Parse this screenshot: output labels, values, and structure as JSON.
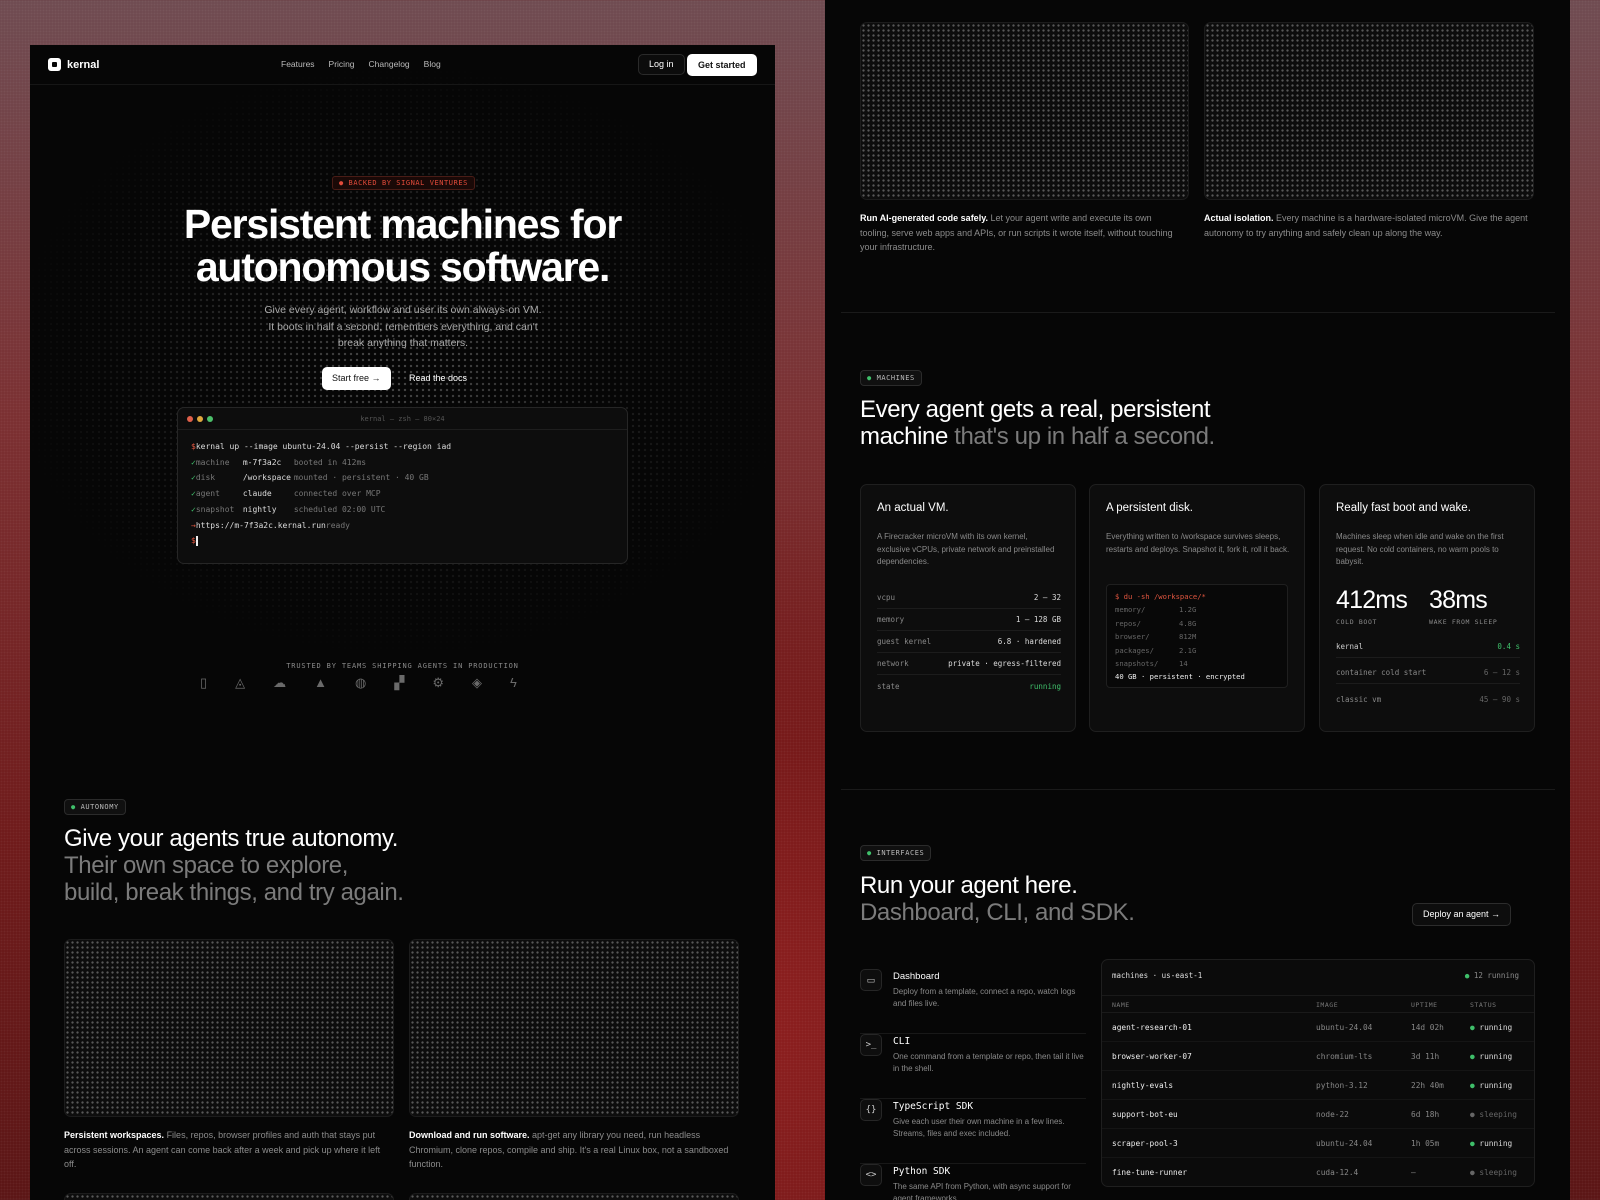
{
  "nav": {
    "brand": "kernal",
    "links": [
      "Features",
      "Pricing",
      "Changelog",
      "Blog"
    ],
    "login": "Log in",
    "cta": "Get started"
  },
  "hero": {
    "badge": "● BACKED BY SIGNAL VENTURES",
    "title_line1": "Persistent machines for",
    "title_line2": "autonomous software.",
    "subtitle": "Give every agent, workflow and user its own always-on VM. It boots in half a second, remembers everything, and can't break anything that matters.",
    "start_free": "Start free →",
    "read_docs": "Read the docs"
  },
  "terminal": {
    "title": "kernal — zsh — 80×24",
    "command": "kernal up --image ubuntu-24.04 --persist --region iad",
    "lines": [
      {
        "mark": "✓",
        "key": "machine",
        "val": "m-7f3a2c",
        "note": "booted in 412ms"
      },
      {
        "mark": "✓",
        "key": "disk",
        "val": "/workspace",
        "note": "mounted · persistent · 40 GB"
      },
      {
        "mark": "✓",
        "key": "agent",
        "val": "claude",
        "note": "connected over MCP"
      },
      {
        "mark": "✓",
        "key": "snapshot",
        "val": "nightly",
        "note": "scheduled 02:00 UTC"
      }
    ],
    "url": "https://m-7f3a2c.kernal.run",
    "url_note": "ready",
    "prompt": "$"
  },
  "trusted": {
    "label": "TRUSTED BY TEAMS SHIPPING AGENTS IN PRODUCTION",
    "logos": [
      "▯",
      "◬",
      "☁",
      "▲",
      "◍",
      "▞",
      "⚙",
      "◈",
      "ϟ"
    ]
  },
  "autonomy": {
    "badge": "AUTONOMY",
    "title": "Give your agents true autonomy.",
    "sub1": "Their own space to explore,",
    "sub2": "build, break things, and try again.",
    "c1_bold": "Persistent workspaces.",
    "c1_text": " Files, repos, browser profiles and auth that stays put across sessions. An agent can come back after a week and pick up where it left off.",
    "c2_bold": "Download and run software.",
    "c2_text": " apt-get any library you need, run headless Chromium, clone repos, compile and ship. It's a real Linux box, not a sandboxed function."
  },
  "top": {
    "c1_bold": "Run AI-generated code safely.",
    "c1_text": " Let your agent write and execute its own tooling, serve web apps and APIs, or run scripts it wrote itself, without touching your infrastructure.",
    "c2_bold": "Actual isolation.",
    "c2_text": " Every machine is a hardware-isolated microVM. Give the agent autonomy to try anything and safely clean up along the way."
  },
  "machines": {
    "badge": "MACHINES",
    "title1": "Every agent gets a real, persistent",
    "title2": "machine",
    "title2_dim": " that's up in half a second.",
    "vm": {
      "title": "An actual VM.",
      "desc": "A Firecracker microVM with its own kernel, exclusive vCPUs, private network and preinstalled dependencies.",
      "specs": [
        {
          "k": "vcpu",
          "v": "2 – 32"
        },
        {
          "k": "memory",
          "v": "1 – 128 GB"
        },
        {
          "k": "guest kernel",
          "v": "6.8 · hardened"
        },
        {
          "k": "network",
          "v": "private · egress-filtered"
        },
        {
          "k": "state",
          "v": "running"
        }
      ]
    },
    "disk": {
      "title": "A persistent disk.",
      "desc": "Everything written to /workspace survives sleeps, restarts and deploys. Snapshot it, fork it, roll it back.",
      "cmd": "$ du -sh /workspace/*",
      "rows": [
        {
          "k": "memory/",
          "v": "1.2G"
        },
        {
          "k": "repos/",
          "v": "4.8G"
        },
        {
          "k": "browser/",
          "v": "812M"
        },
        {
          "k": "packages/",
          "v": "2.1G"
        },
        {
          "k": "snapshots/",
          "v": "14"
        }
      ],
      "total": "40 GB · persistent · encrypted"
    },
    "boot": {
      "title": "Really fast boot and wake.",
      "desc": "Machines sleep when idle and wake on the first request. No cold containers, no warm pools to babysit.",
      "n1": "412ms",
      "l1": "COLD BOOT",
      "n2": "38ms",
      "l2": "WAKE FROM SLEEP",
      "rows": [
        {
          "k": "kernal",
          "v": "0.4 s"
        },
        {
          "k": "container cold start",
          "v": "6 – 12 s"
        },
        {
          "k": "classic vm",
          "v": "45 – 90 s"
        }
      ]
    }
  },
  "interfaces": {
    "badge": "INTERFACES",
    "title": "Run your agent here.",
    "sub": "Dashboard, CLI, and SDK.",
    "deploy": "Deploy an agent →",
    "items": [
      {
        "icon": "▭",
        "title": "Dashboard",
        "desc": "Deploy from a template, connect a repo, watch logs and files live."
      },
      {
        "icon": ">_",
        "title": "CLI",
        "desc": "One command from a template or repo, then tail it live in the shell."
      },
      {
        "icon": "{}",
        "title": "TypeScript SDK",
        "desc": "Give each user their own machine in a few lines. Streams, files and exec included."
      },
      {
        "icon": "<>",
        "title": "Python SDK",
        "desc": "The same API from Python, with async support for agent frameworks."
      }
    ],
    "table": {
      "head": "machines · us-east-1",
      "count": "● 12 running",
      "cols": [
        "NAME",
        "IMAGE",
        "UPTIME",
        "STATUS"
      ],
      "rows": [
        {
          "name": "agent-research-01",
          "image": "ubuntu-24.04",
          "uptime": "14d 02h",
          "status": "● running"
        },
        {
          "name": "browser-worker-07",
          "image": "chromium-lts",
          "uptime": "3d 11h",
          "status": "● running"
        },
        {
          "name": "nightly-evals",
          "image": "python-3.12",
          "uptime": "22h 40m",
          "status": "● running"
        },
        {
          "name": "support-bot-eu",
          "image": "node-22",
          "uptime": "6d 18h",
          "status": "● sleeping"
        },
        {
          "name": "scraper-pool-3",
          "image": "ubuntu-24.04",
          "uptime": "1h 05m",
          "status": "● running"
        },
        {
          "name": "fine-tune-runner",
          "image": "cuda-12.4",
          "uptime": "—",
          "status": "● sleeping"
        }
      ]
    }
  }
}
